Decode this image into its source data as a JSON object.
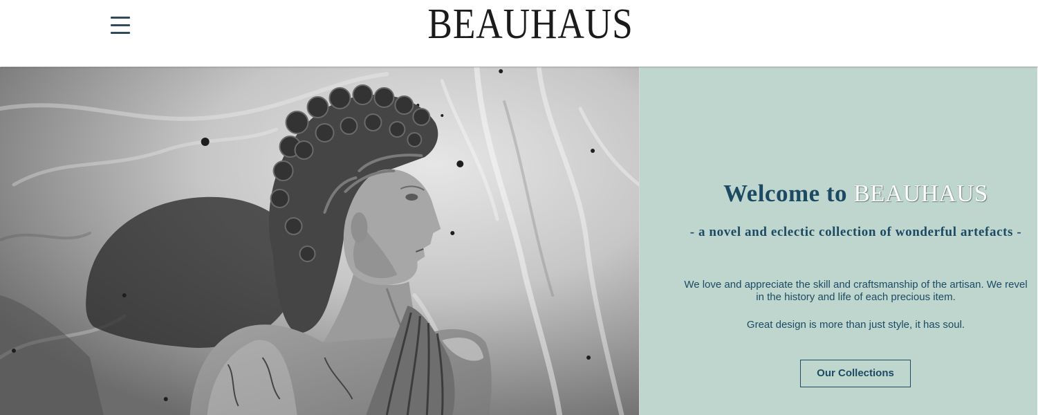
{
  "header": {
    "brand": "BEAUHAUS",
    "menu_icon": "menu-icon"
  },
  "welcome": {
    "heading_prefix": "Welcome to",
    "heading_brand": "BEAUHAUS",
    "tagline": "- a novel and eclectic collection of wonderful artefacts -",
    "intro_lines": [
      "We love and appreciate the skill and craftsmanship of the artisan. We revel",
      "in the history and life of each precious item."
    ],
    "closing": "Great design is more than just style, it has soul.",
    "cta_label": "Our Collections"
  },
  "colors": {
    "header_bg": "#ffffff",
    "panel_bg": "#bfd6cf",
    "accent_text": "#1c4a63",
    "logo": "#1b1b1b",
    "menu": "#2f4a5a"
  }
}
